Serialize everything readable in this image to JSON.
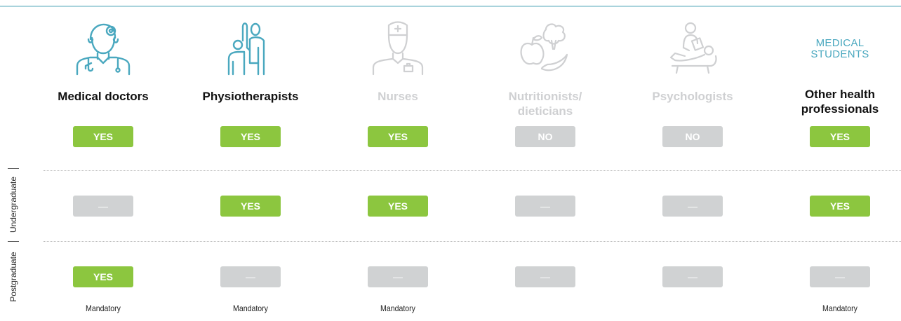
{
  "columns": [
    {
      "id": "doctors",
      "label": "Medical doctors",
      "icon": "doctor-icon",
      "muted": false,
      "row1": "YES",
      "row2": "—",
      "row3": "YES",
      "note": "Mandatory"
    },
    {
      "id": "physio",
      "label": "Physiotherapists",
      "icon": "physiotherapist-icon",
      "muted": false,
      "row1": "YES",
      "row2": "YES",
      "row3": "—",
      "note": "Mandatory"
    },
    {
      "id": "nurses",
      "label": "Nurses",
      "icon": "nurse-icon",
      "muted": true,
      "row1": "YES",
      "row2": "YES",
      "row3": "—",
      "note": "Mandatory"
    },
    {
      "id": "nutritionists",
      "label": "Nutritionists/\ndieticians",
      "icon": "fruit-vegetables-icon",
      "muted": true,
      "row1": "NO",
      "row2": "—",
      "row3": "—",
      "note": ""
    },
    {
      "id": "psychologists",
      "label": "Psychologists",
      "icon": "psychologist-icon",
      "muted": true,
      "row1": "NO",
      "row2": "—",
      "row3": "—",
      "note": ""
    },
    {
      "id": "other",
      "label": "Other health\nprofessionals",
      "icon": "",
      "muted": false,
      "row1": "YES",
      "row2": "YES",
      "row3": "—",
      "note": "Mandatory"
    }
  ],
  "students_heading": "MEDICAL\nSTUDENTS",
  "side_labels": {
    "undergraduate": "Undergraduate",
    "postgraduate": "Postgraduate"
  },
  "colors": {
    "yes": "#8cc63f",
    "neutral": "#d0d2d3",
    "teal": "#4aa8bf",
    "muted_text": "#cfd0d2"
  }
}
